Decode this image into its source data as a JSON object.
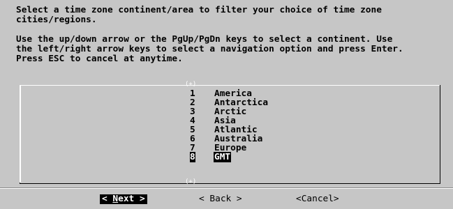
{
  "header": {
    "line1": "Select a time zone continent/area to filter your choice of time zone",
    "line2": "cities/regions.",
    "line3": "Use the up/down arrow or the PgUp/PgDn keys to select a continent. Use",
    "line4": "the left/right arrow keys to select a navigation option and press Enter.",
    "line5": "Press ESC to cancel at anytime."
  },
  "scroll": {
    "top": "(+)",
    "bottom": "(+)"
  },
  "list": {
    "items": [
      {
        "num": "1",
        "label": "America"
      },
      {
        "num": "2",
        "label": "Antarctica"
      },
      {
        "num": "3",
        "label": "Arctic"
      },
      {
        "num": "4",
        "label": "Asia"
      },
      {
        "num": "5",
        "label": "Atlantic"
      },
      {
        "num": "6",
        "label": "Australia"
      },
      {
        "num": "7",
        "label": "Europe"
      },
      {
        "num": "8",
        "label": "GMT"
      }
    ],
    "selected_index": 7
  },
  "buttons": {
    "next": "< Next >",
    "back": "< Back >",
    "cancel": "<Cancel>"
  }
}
